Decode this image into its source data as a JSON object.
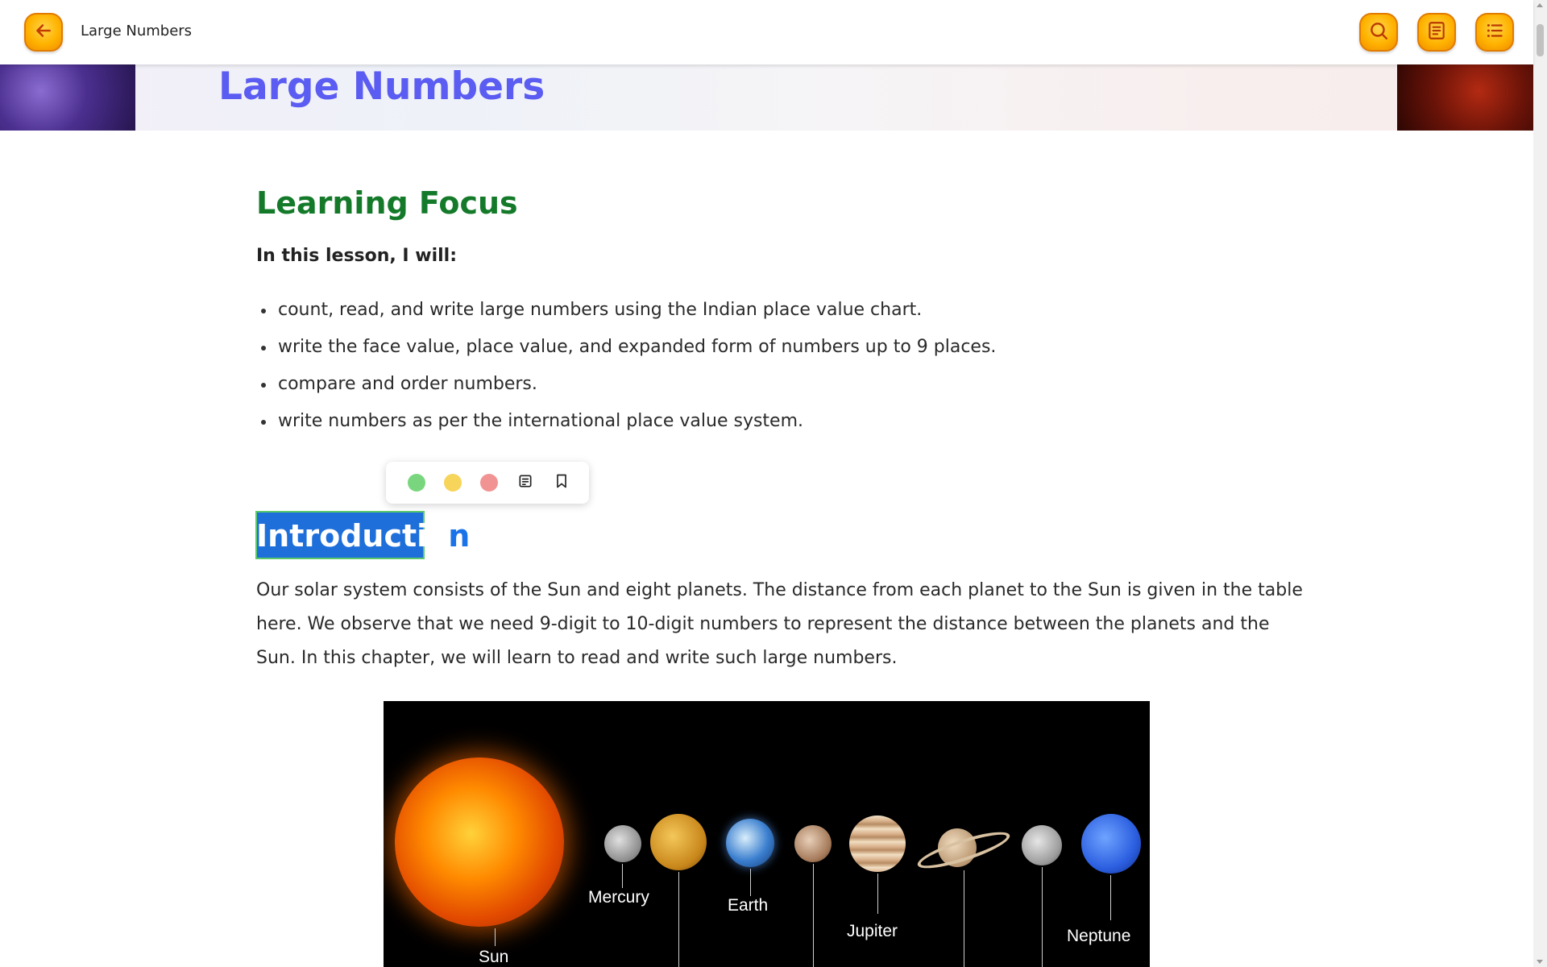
{
  "header": {
    "app_title": "Large Numbers",
    "back_icon": "arrow-left-icon",
    "search_icon": "search-icon",
    "notes_icon": "note-icon",
    "toc_icon": "list-icon",
    "accent_color": "#ffb300"
  },
  "banner": {
    "title": "Large Numbers"
  },
  "learning_focus": {
    "heading": "Learning Focus",
    "intro": "In this lesson, I will:",
    "items": [
      "count, read, and write large numbers using the Indian place value chart.",
      "write the face value, place value, and expanded form of numbers up to 9 places.",
      "compare and order numbers.",
      "write numbers as per the international place value system."
    ]
  },
  "highlight_toolbar": {
    "colors": [
      "#7ad67e",
      "#f7d45a",
      "#f29393"
    ],
    "note_icon": "note-icon",
    "bookmark_icon": "bookmark-icon"
  },
  "introduction": {
    "heading_selected": "Introductio",
    "heading_rest": "n",
    "paragraph": "Our solar system consists of the Sun and eight planets. The distance from each planet to the Sun is given in the table here. We observe that we need 9-digit to 10-digit numbers to represent the distance between the planets and the Sun. In this chapter, we will learn to read and write such large numbers."
  },
  "solar_image": {
    "labels": {
      "sun": "Sun",
      "mercury": "Mercury",
      "earth": "Earth",
      "jupiter": "Jupiter",
      "neptune": "Neptune"
    }
  }
}
